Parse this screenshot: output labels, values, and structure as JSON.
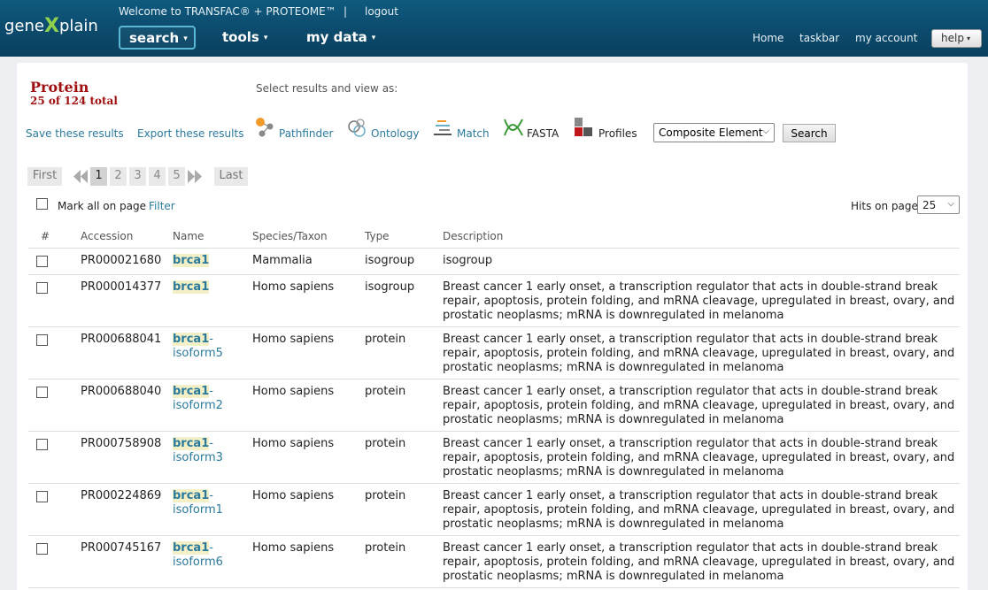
{
  "header": {
    "logo_left": "gene",
    "logo_x": "X",
    "logo_right": "plain",
    "welcome": "Welcome to TRANSFAC® + PROTEOME™",
    "separator": "|",
    "logout": "logout",
    "nav": {
      "search": "search",
      "tools": "tools",
      "mydata": "my data"
    },
    "links": {
      "home": "Home",
      "taskbar": "taskbar",
      "account": "my account",
      "help": "help"
    },
    "caret": "▾"
  },
  "result": {
    "title": "Protein",
    "count": "25 of 124 total",
    "select_label": "Select results and view as:",
    "save": "Save these results",
    "export": "Export these results",
    "views": {
      "pathfinder": "Pathfinder",
      "ontology": "Ontology",
      "match": "Match",
      "fasta": "FASTA",
      "profiles": "Profiles"
    },
    "composite_value": "Composite Element",
    "search_button": "Search"
  },
  "pager": {
    "first": "First",
    "last": "Last",
    "pages": [
      "1",
      "2",
      "3",
      "4",
      "5"
    ]
  },
  "controls": {
    "mark_all": "Mark all on page",
    "filter": "Filter",
    "hits_label": "Hits on page",
    "hits_value": "25"
  },
  "table": {
    "headers": {
      "num": "#",
      "accession": "Accession",
      "name": "Name",
      "species": "Species/Taxon",
      "type": "Type",
      "description": "Description"
    },
    "rows": [
      {
        "accession": "PR000021680",
        "name_hl": "brca1",
        "name_rest": "",
        "species": "Mammalia",
        "type": "isogroup",
        "description": "isogroup"
      },
      {
        "accession": "PR000014377",
        "name_hl": "brca1",
        "name_rest": "",
        "species": "Homo sapiens",
        "type": "isogroup",
        "description": "Breast cancer 1 early onset, a transcription regulator that acts in double-strand break repair, apoptosis, protein folding, and mRNA cleavage, upregulated in breast, ovary, and prostatic neoplasms; mRNA is downregulated in melanoma"
      },
      {
        "accession": "PR000688041",
        "name_hl": "brca1",
        "name_rest": "-isoform5",
        "species": "Homo sapiens",
        "type": "protein",
        "description": "Breast cancer 1 early onset, a transcription regulator that acts in double-strand break repair, apoptosis, protein folding, and mRNA cleavage, upregulated in breast, ovary, and prostatic neoplasms; mRNA is downregulated in melanoma"
      },
      {
        "accession": "PR000688040",
        "name_hl": "brca1",
        "name_rest": "-isoform2",
        "species": "Homo sapiens",
        "type": "protein",
        "description": "Breast cancer 1 early onset, a transcription regulator that acts in double-strand break repair, apoptosis, protein folding, and mRNA cleavage, upregulated in breast, ovary, and prostatic neoplasms; mRNA is downregulated in melanoma"
      },
      {
        "accession": "PR000758908",
        "name_hl": "brca1",
        "name_rest": "-isoform3",
        "species": "Homo sapiens",
        "type": "protein",
        "description": "Breast cancer 1 early onset, a transcription regulator that acts in double-strand break repair, apoptosis, protein folding, and mRNA cleavage, upregulated in breast, ovary, and prostatic neoplasms; mRNA is downregulated in melanoma"
      },
      {
        "accession": "PR000224869",
        "name_hl": "brca1",
        "name_rest": "-isoform1",
        "species": "Homo sapiens",
        "type": "protein",
        "description": "Breast cancer 1 early onset, a transcription regulator that acts in double-strand break repair, apoptosis, protein folding, and mRNA cleavage, upregulated in breast, ovary, and prostatic neoplasms; mRNA is downregulated in melanoma"
      },
      {
        "accession": "PR000745167",
        "name_hl": "brca1",
        "name_rest": "-isoform6",
        "species": "Homo sapiens",
        "type": "protein",
        "description": "Breast cancer 1 early onset, a transcription regulator that acts in double-strand break repair, apoptosis, protein folding, and mRNA cleavage, upregulated in breast, ovary, and prostatic neoplasms; mRNA is downregulated in melanoma"
      }
    ]
  }
}
